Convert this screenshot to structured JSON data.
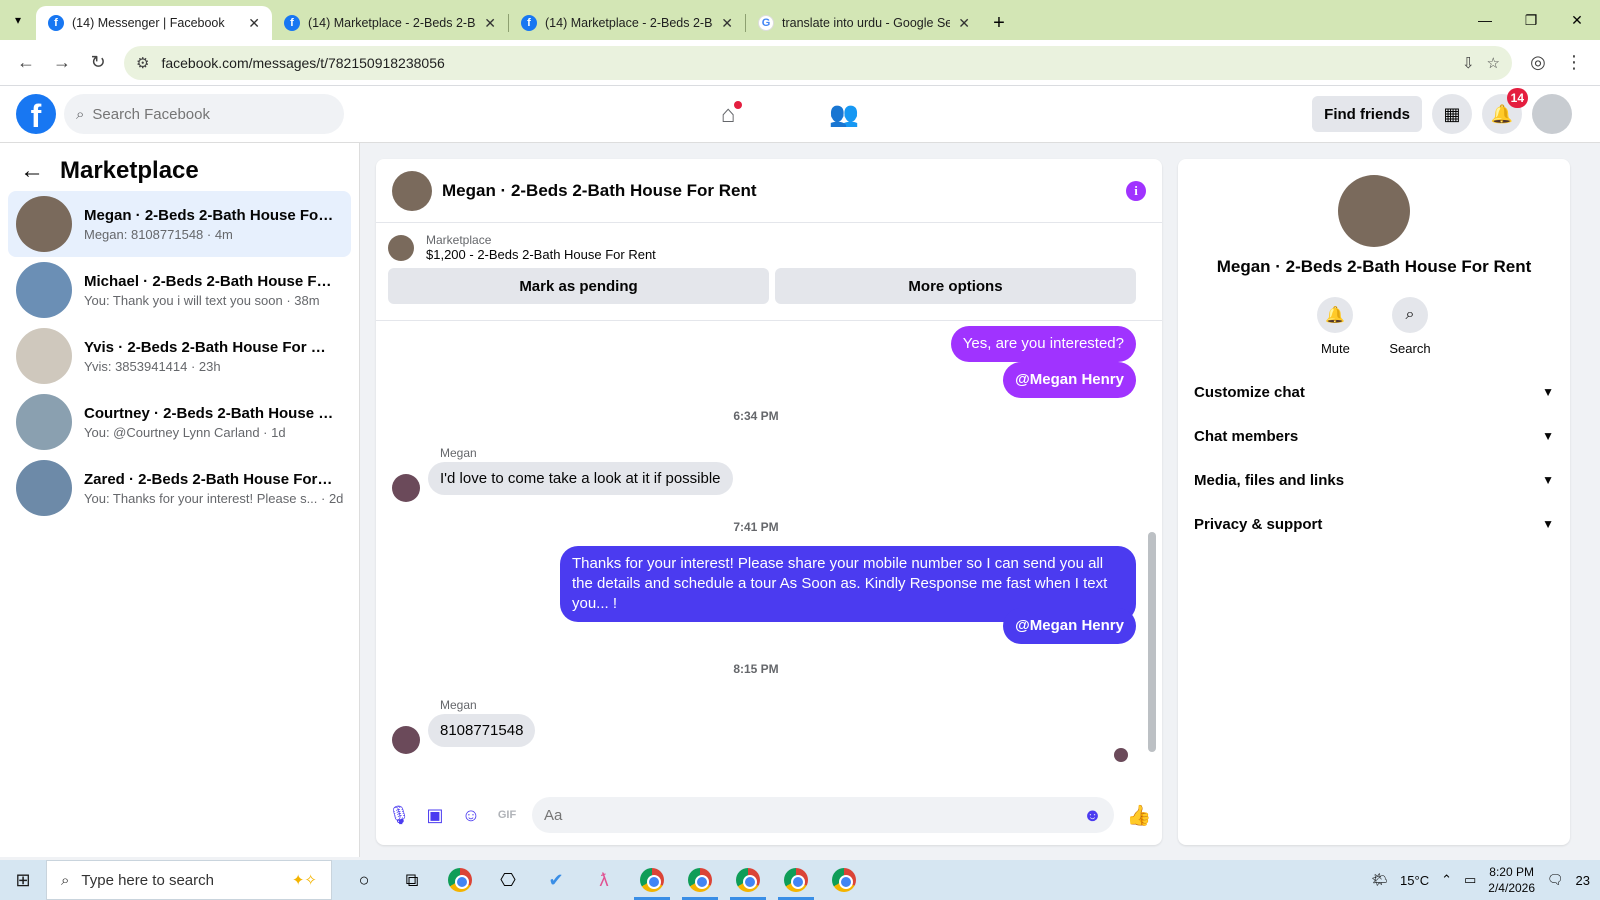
{
  "browser": {
    "tabs": [
      {
        "title": "(14) Messenger | Facebook",
        "favicon": "f",
        "active": true
      },
      {
        "title": "(14) Marketplace - 2-Beds 2-Ba",
        "favicon": "f",
        "active": false
      },
      {
        "title": "(14) Marketplace - 2-Beds 2-Ba",
        "favicon": "f",
        "active": false
      },
      {
        "title": "translate into urdu - Google Se",
        "favicon": "G",
        "active": false
      }
    ],
    "url": "facebook.com/messages/t/782150918238056"
  },
  "fb": {
    "logo": "f",
    "search_placeholder": "Search Facebook",
    "find_friends": "Find friends",
    "notif_count": "14"
  },
  "sidebar": {
    "title": "Marketplace",
    "conversations": [
      {
        "name": "Megan · 2-Beds 2-Bath House For ...",
        "preview": "Megan: 8108771548 · 4m",
        "color": "#7a6a5c",
        "active": true
      },
      {
        "name": "Michael · 2-Beds 2-Bath House For...",
        "preview": "You: Thank you i will text you soon · 38m",
        "color": "#6b8fb5",
        "active": false
      },
      {
        "name": "Yvis · 2-Beds 2-Bath House For Rent",
        "preview": "Yvis: 3853941414 · 23h",
        "color": "#cfc8bd",
        "active": false
      },
      {
        "name": "Courtney · 2-Beds 2-Bath House F...",
        "preview": "You: @Courtney Lynn Carland · 1d",
        "color": "#8aa0b0",
        "active": false
      },
      {
        "name": "Zared · 2-Beds 2-Bath House For R...",
        "preview": "You: Thanks for your interest! Please s... · 2d",
        "color": "#6d8aa8",
        "active": false
      }
    ]
  },
  "chat": {
    "title": "Megan · 2-Beds 2-Bath House For Rent",
    "marketplace_label": "Marketplace",
    "listing": "$1,200 - 2-Beds 2-Bath House For Rent",
    "mark_pending": "Mark as pending",
    "more_options": "More options",
    "messages": {
      "out1": "Yes, are you interested?",
      "mention1": "@Megan Henry",
      "time1": "6:34 PM",
      "sender1": "Megan",
      "in1": "I'd love to come take a look at it if possible",
      "time2": "7:41 PM",
      "out2": "Thanks for your interest! Please share your mobile number so I can send you all the details and schedule a tour As Soon as. Kindly Response me fast when I text you... !",
      "mention2": "@Megan Henry",
      "time3": "8:15 PM",
      "sender2": "Megan",
      "in2": "8108771548"
    },
    "composer_placeholder": "Aa"
  },
  "right_panel": {
    "name": "Megan · 2-Beds 2-Bath House For Rent",
    "mute": "Mute",
    "search": "Search",
    "sections": [
      "Customize chat",
      "Chat members",
      "Media, files and links",
      "Privacy & support"
    ]
  },
  "taskbar": {
    "search_placeholder": "Type here to search",
    "weather": "15°C",
    "time": "8:20 PM",
    "date": "2/4/2026",
    "notif": "23"
  },
  "colors": {
    "fb_blue": "#1877f2",
    "messenger_purple": "#a033ff",
    "messenger_blue": "#4b3bf0"
  }
}
